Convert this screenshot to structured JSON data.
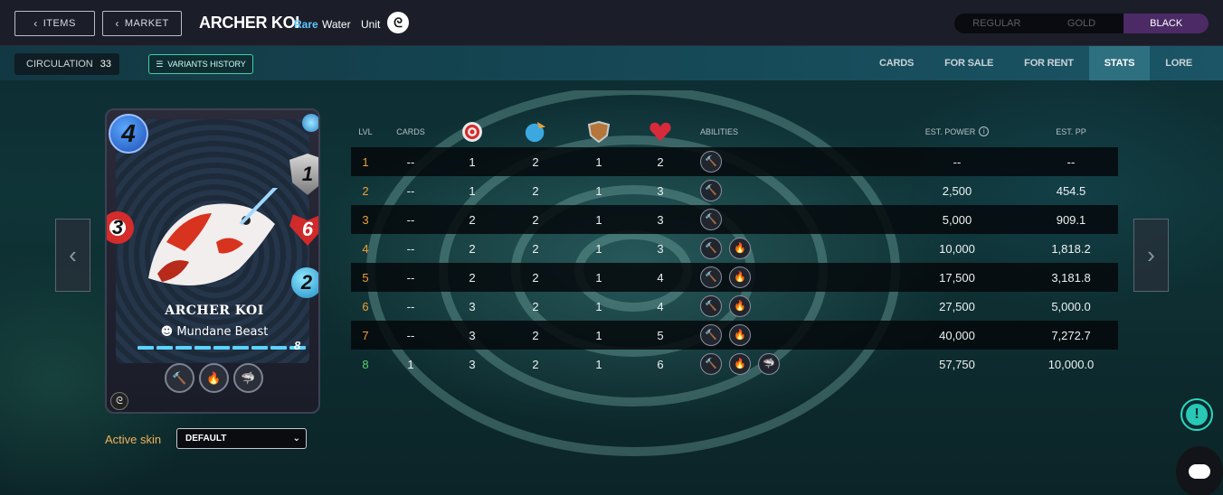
{
  "header": {
    "items_label": "ITEMS",
    "market_label": "MARKET",
    "card_title": "ARCHER KOI",
    "rarity": "Rare",
    "element": "Water",
    "card_type": "Unit",
    "edition_icon": "edition-icon",
    "foils": [
      "REGULAR",
      "GOLD",
      "BLACK"
    ],
    "active_foil": "BLACK"
  },
  "subbar": {
    "circulation_label": "CIRCULATION",
    "circulation_value": "33",
    "variants_label": "VARIANTS HISTORY",
    "tabs": [
      "CARDS",
      "FOR SALE",
      "FOR RENT",
      "STATS",
      "LORE"
    ],
    "active_tab": "STATS"
  },
  "card": {
    "mana": "4",
    "ranged": "3",
    "armor": "1",
    "health": "6",
    "speed": "2",
    "name": "ARCHER KOI",
    "type": "Mundane Beast",
    "level": "8",
    "abilities": [
      "hammer-icon",
      "enrage-icon",
      "shark-icon"
    ]
  },
  "skin": {
    "label": "Active skin",
    "value": "DEFAULT"
  },
  "table": {
    "headers": {
      "lvl": "LVL",
      "cards": "CARDS",
      "attack_icon": "ranged-attack-icon",
      "speed_icon": "speed-icon",
      "armor_icon": "armor-icon",
      "health_icon": "health-icon",
      "abilities": "ABILITIES",
      "power": "EST. POWER",
      "pp": "EST. PP"
    },
    "rows": [
      {
        "lvl": "1",
        "cards": "--",
        "atk": "1",
        "spd": "2",
        "arm": "1",
        "hp": "2",
        "power": "--",
        "pp": "--",
        "abilities": [
          "hammer"
        ]
      },
      {
        "lvl": "2",
        "cards": "--",
        "atk": "1",
        "spd": "2",
        "arm": "1",
        "hp": "3",
        "power": "2,500",
        "pp": "454.5",
        "abilities": [
          "hammer"
        ]
      },
      {
        "lvl": "3",
        "cards": "--",
        "atk": "2",
        "spd": "2",
        "arm": "1",
        "hp": "3",
        "power": "5,000",
        "pp": "909.1",
        "abilities": [
          "hammer"
        ]
      },
      {
        "lvl": "4",
        "cards": "--",
        "atk": "2",
        "spd": "2",
        "arm": "1",
        "hp": "3",
        "power": "10,000",
        "pp": "1,818.2",
        "abilities": [
          "hammer",
          "enrage"
        ]
      },
      {
        "lvl": "5",
        "cards": "--",
        "atk": "2",
        "spd": "2",
        "arm": "1",
        "hp": "4",
        "power": "17,500",
        "pp": "3,181.8",
        "abilities": [
          "hammer",
          "enrage"
        ]
      },
      {
        "lvl": "6",
        "cards": "--",
        "atk": "3",
        "spd": "2",
        "arm": "1",
        "hp": "4",
        "power": "27,500",
        "pp": "5,000.0",
        "abilities": [
          "hammer",
          "enrage"
        ]
      },
      {
        "lvl": "7",
        "cards": "--",
        "atk": "3",
        "spd": "2",
        "arm": "1",
        "hp": "5",
        "power": "40,000",
        "pp": "7,272.7",
        "abilities": [
          "hammer",
          "enrage"
        ]
      },
      {
        "lvl": "8",
        "cards": "1",
        "atk": "3",
        "spd": "2",
        "arm": "1",
        "hp": "6",
        "power": "57,750",
        "pp": "10,000.0",
        "abilities": [
          "hammer",
          "enrage",
          "shark"
        ]
      }
    ]
  },
  "colors": {
    "level_normal": "#f0a030",
    "level_max": "#58d270",
    "rarity": "#5ec6ff",
    "accent_foil": "#4b2a66"
  }
}
